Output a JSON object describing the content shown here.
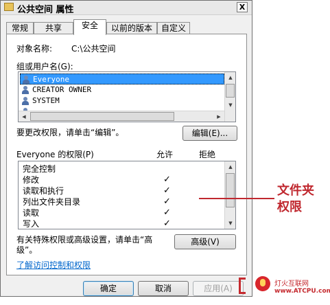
{
  "window": {
    "title": "公共空间 属性",
    "close_label": "X"
  },
  "tabs": [
    {
      "label": "常规",
      "active": false
    },
    {
      "label": "共享",
      "active": false
    },
    {
      "label": "安全",
      "active": true
    },
    {
      "label": "以前的版本",
      "active": false
    },
    {
      "label": "自定义",
      "active": false
    }
  ],
  "security": {
    "object_name_label": "对象名称:",
    "object_name_value": "C:\\公共空间",
    "group_label": "组或用户名(G):",
    "users": [
      {
        "name": "Everyone",
        "selected": true
      },
      {
        "name": "CREATOR OWNER",
        "selected": false
      },
      {
        "name": "SYSTEM",
        "selected": false
      },
      {
        "name": "...",
        "selected": false
      }
    ],
    "change_hint": "要更改权限，请单击“编辑”。",
    "edit_button": "编辑(E)...",
    "perm_header": "Everyone 的权限(P)",
    "allow_header": "允许",
    "deny_header": "拒绝",
    "permissions": [
      {
        "name": "完全控制",
        "allow": false,
        "deny": false
      },
      {
        "name": "修改",
        "allow": true,
        "deny": false
      },
      {
        "name": "读取和执行",
        "allow": true,
        "deny": false
      },
      {
        "name": "列出文件夹目录",
        "allow": true,
        "deny": false
      },
      {
        "name": "读取",
        "allow": true,
        "deny": false
      },
      {
        "name": "写入",
        "allow": true,
        "deny": false
      }
    ],
    "check_glyph": "✓",
    "advanced_hint_1": "有关特殊权限或高级设置，请单击“高",
    "advanced_hint_2": "级”。",
    "advanced_button": "高级(V)",
    "link": "了解访问控制和权限"
  },
  "footer": {
    "ok": "确定",
    "cancel": "取消",
    "apply": "应用(A)"
  },
  "annotation": {
    "line1": "文件夹",
    "line2": "权限",
    "color": "#c0282f"
  },
  "watermark": {
    "line1": "灯火互联网",
    "line2": "www.ATCPU.com"
  }
}
